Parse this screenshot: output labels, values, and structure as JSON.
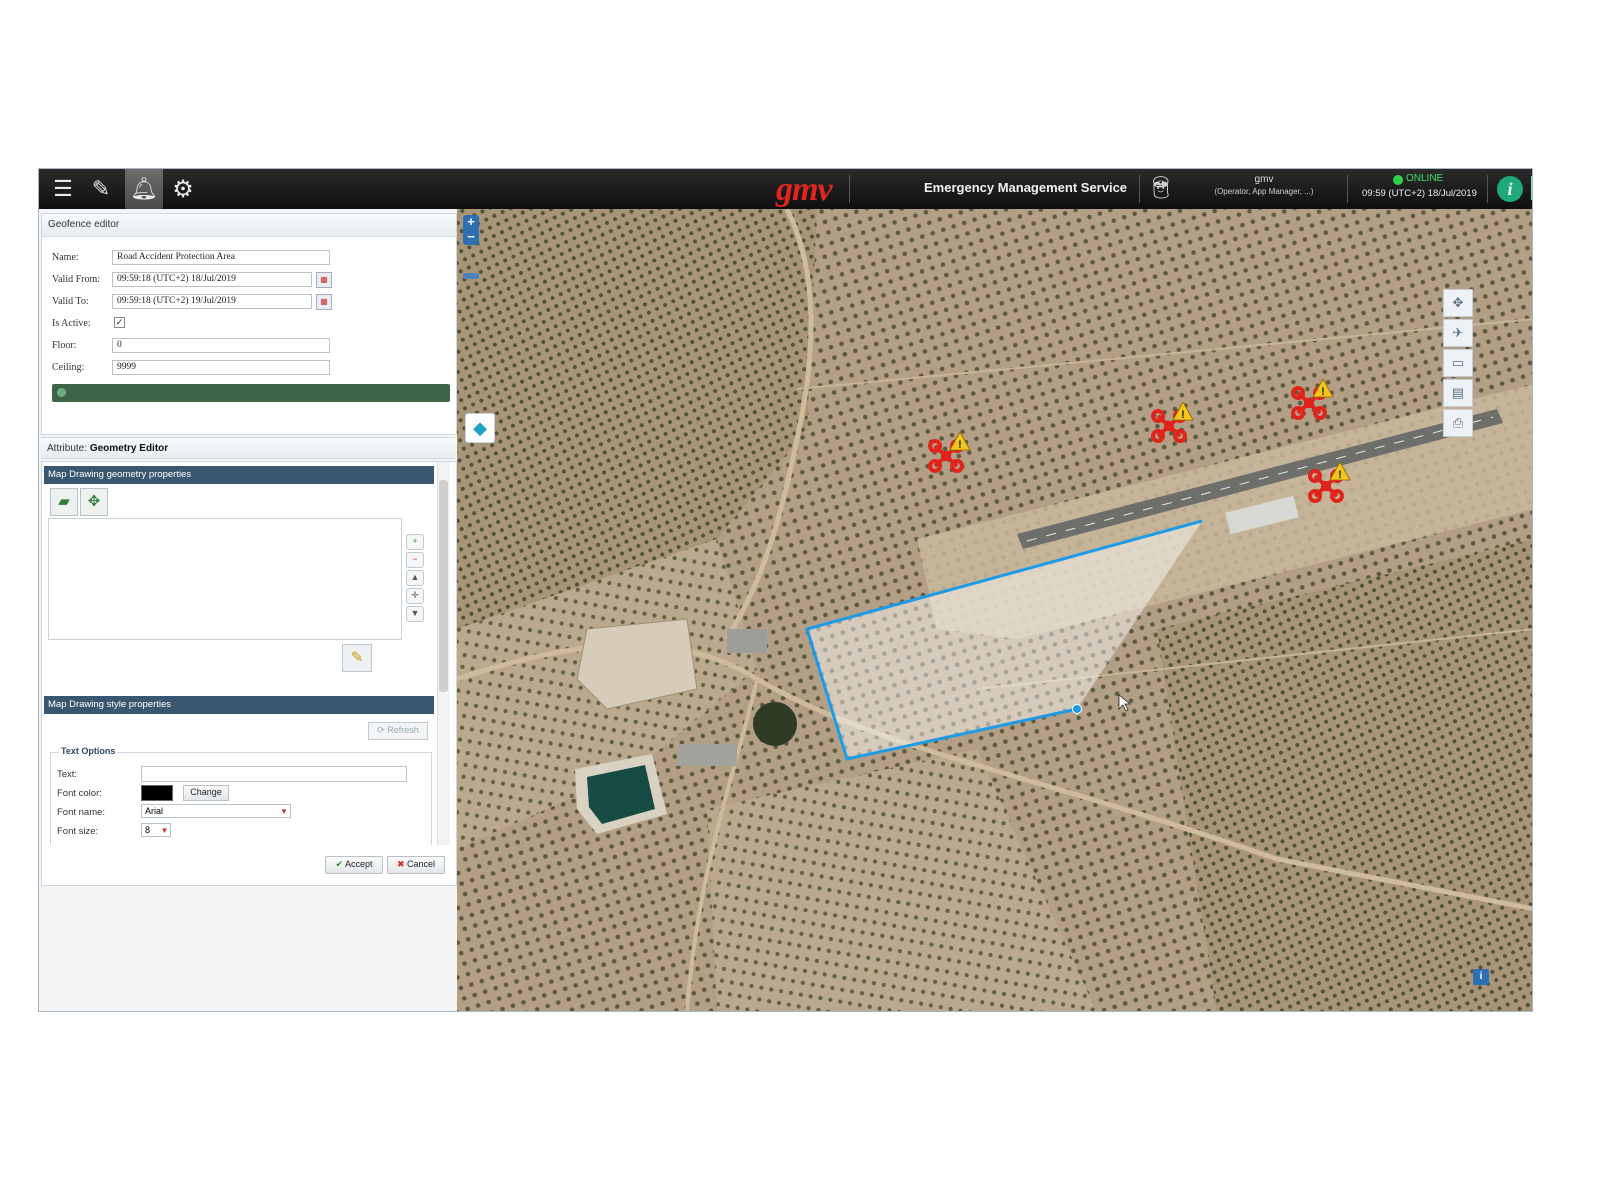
{
  "toolbar": {
    "icons": [
      "list-icon",
      "pencil-icon",
      "bell-icon",
      "gear-icon"
    ],
    "logo": "gmv",
    "service_title": "Emergency Management Service",
    "user_name": "gmv",
    "user_roles": "(Operator, App Manager, ...)",
    "status": "ONLINE",
    "status_color": "#2fd14a",
    "datetime": "09:59 (UTC+2) 18/Jul/2019",
    "info_label": "i"
  },
  "geofence": {
    "title": "Geofence editor",
    "name_label": "Name:",
    "name_value": "Road Accident Protection Area",
    "valid_from_label": "Valid From:",
    "valid_from_value": "09:59:18 (UTC+2) 18/Jul/2019",
    "valid_to_label": "Valid To:",
    "valid_to_value": "09:59:18 (UTC+2) 19/Jul/2019",
    "is_active_label": "Is Active:",
    "is_active": true,
    "floor_label": "Floor:",
    "floor_value": "0",
    "ceiling_label": "Ceiling:",
    "ceiling_value": "9999"
  },
  "attribute": {
    "prefix": "Attribute:",
    "name": "Geometry Editor"
  },
  "geometry_section": {
    "title": "Map Drawing geometry properties"
  },
  "style_section": {
    "title": "Map Drawing style properties",
    "refresh_label": "Refresh",
    "text_options_legend": "Text Options",
    "text_label": "Text:",
    "text_value": "",
    "font_color_label": "Font color:",
    "font_color": "#000000",
    "change_label": "Change",
    "font_name_label": "Font name:",
    "font_name_value": "Arial",
    "font_size_label": "Font size:",
    "font_size_value": "8"
  },
  "dialog": {
    "accept_label": "Accept",
    "cancel_label": "Cancel"
  },
  "map": {
    "zoom_in": "+",
    "zoom_out": "−",
    "accent_color": "#1e9be8",
    "drone_color": "#e0241b",
    "warning_color": "#f5c518",
    "right_tools": [
      "move-icon",
      "measure-icon",
      "ruler-icon",
      "layers-icon",
      "print-icon"
    ]
  }
}
